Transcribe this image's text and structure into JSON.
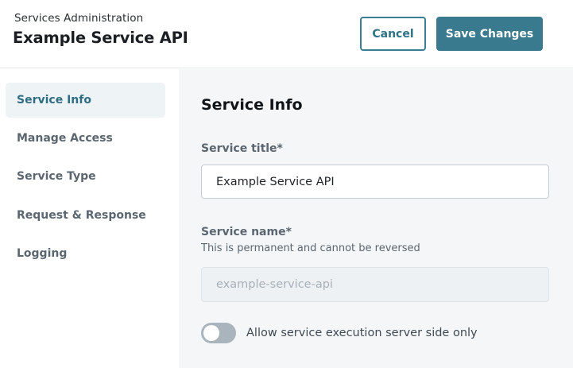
{
  "header": {
    "breadcrumb": "Services Administration",
    "title": "Example Service API",
    "cancel_label": "Cancel",
    "save_label": "Save Changes"
  },
  "sidebar": {
    "items": [
      {
        "label": "Service Info",
        "active": true
      },
      {
        "label": "Manage Access",
        "active": false
      },
      {
        "label": "Service Type",
        "active": false
      },
      {
        "label": "Request & Response",
        "active": false
      },
      {
        "label": "Logging",
        "active": false
      }
    ]
  },
  "main": {
    "section_title": "Service Info",
    "service_title": {
      "label": "Service title*",
      "value": "Example Service API"
    },
    "service_name": {
      "label": "Service name*",
      "help": "This is permanent and cannot be reversed",
      "placeholder": "example-service-api"
    },
    "server_side_toggle": {
      "label": "Allow service execution server side only",
      "checked": false
    }
  },
  "colors": {
    "accent": "#3a7a8e",
    "active_nav_bg": "#eef3f6",
    "content_bg": "#f4f6f8"
  }
}
